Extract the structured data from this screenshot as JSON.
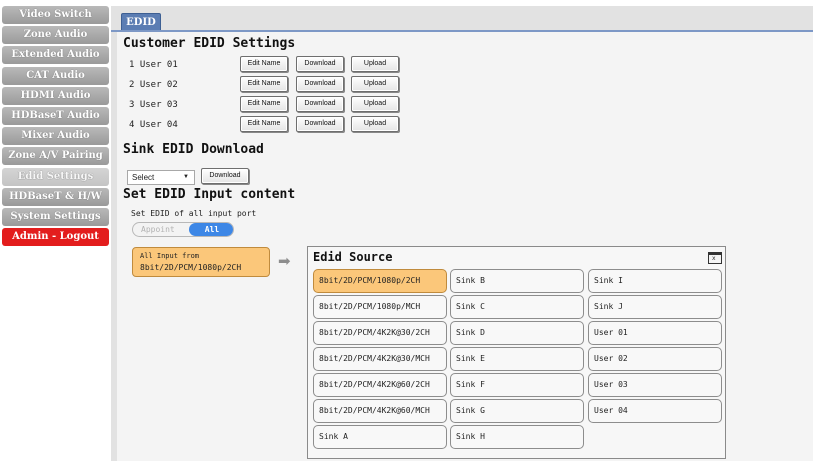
{
  "sidebar": {
    "items": [
      {
        "label": "Video Switch"
      },
      {
        "label": "Zone Audio"
      },
      {
        "label": "Extended Audio"
      },
      {
        "label": "CAT Audio"
      },
      {
        "label": "HDMI Audio"
      },
      {
        "label": "HDBaseT Audio"
      },
      {
        "label": "Mixer Audio"
      },
      {
        "label": "Zone A/V Pairing"
      },
      {
        "label": "Edid Settings"
      },
      {
        "label": "HDBaseT & H/W"
      },
      {
        "label": "System Settings"
      },
      {
        "label": "Admin - Logout"
      }
    ],
    "active_index": 8,
    "logout_color": "#e31d1d"
  },
  "tab": {
    "label": "EDID"
  },
  "customer": {
    "title": "Customer EDID Settings",
    "users": [
      {
        "name": "1 User 01"
      },
      {
        "name": "2 User 02"
      },
      {
        "name": "3 User 03"
      },
      {
        "name": "4 User 04"
      }
    ],
    "edit_label": "Edit Name",
    "download_label": "Download",
    "upload_label": "Upload"
  },
  "sink": {
    "title": "Sink EDID Download",
    "select_value": "Select",
    "download_label": "Download"
  },
  "input_content": {
    "title": "Set EDID Input content",
    "label": "Set EDID of all input port",
    "toggle_appoint": "Appoint",
    "toggle_all": "All",
    "toggle_selected": "All"
  },
  "all_input": {
    "line1": "All Input from",
    "line2": "8bit/2D/PCM/1080p/2CH"
  },
  "edid_source": {
    "title": "Edid Source",
    "close_glyph": "x",
    "columns": [
      [
        "8bit/2D/PCM/1080p/2CH",
        "8bit/2D/PCM/1080p/MCH",
        "8bit/2D/PCM/4K2K@30/2CH",
        "8bit/2D/PCM/4K2K@30/MCH",
        "8bit/2D/PCM/4K2K@60/2CH",
        "8bit/2D/PCM/4K2K@60/MCH",
        "Sink A"
      ],
      [
        "Sink B",
        "Sink C",
        "Sink D",
        "Sink E",
        "Sink F",
        "Sink G",
        "Sink H"
      ],
      [
        "Sink I",
        "Sink J",
        "User 01",
        "User 02",
        "User 03",
        "User 04"
      ]
    ],
    "selected": "8bit/2D/PCM/1080p/2CH",
    "highlight_color": "#fbc77a"
  },
  "icons": {
    "arrow": "right-arrow-icon",
    "close": "close-icon"
  }
}
